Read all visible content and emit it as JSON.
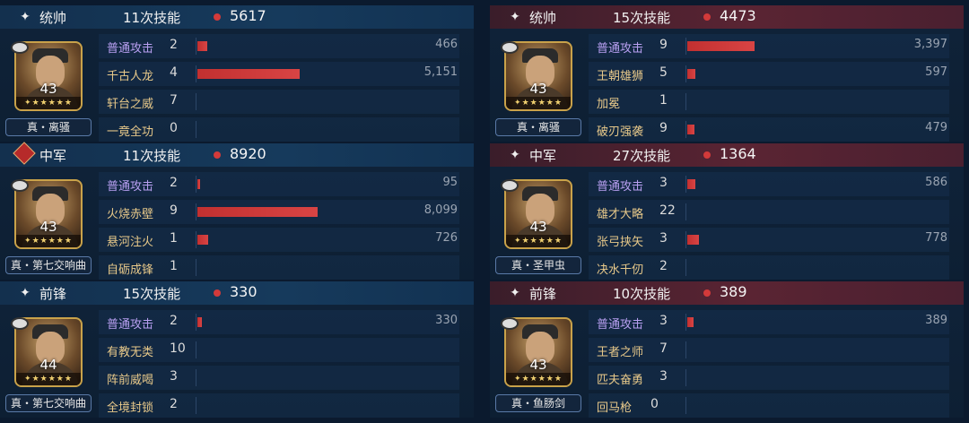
{
  "panels": [
    {
      "role": "统帅",
      "role_icon": "sparkle-icon",
      "skill_count": "11次技能",
      "damage_total": "5617",
      "level": "43",
      "stars": "✦★★★★★",
      "badge": "真・离骚",
      "skills": [
        {
          "name": "普通攻击",
          "count": "2",
          "damage": "466",
          "bar": 0.084,
          "type": "basic"
        },
        {
          "name": "千古人龙",
          "count": "4",
          "damage": "5,151",
          "bar": 0.85,
          "type": "skill"
        },
        {
          "name": "轩台之威",
          "count": "7",
          "damage": "",
          "bar": 0,
          "type": "skill"
        },
        {
          "name": "一竟全功",
          "count": "0",
          "damage": "",
          "bar": 0,
          "type": "skill"
        }
      ]
    },
    {
      "role": "中军",
      "role_icon": "diamond-icon",
      "skill_count": "11次技能",
      "damage_total": "8920",
      "level": "43",
      "stars": "✦★★★★★",
      "badge": "真・第七交响曲",
      "skills": [
        {
          "name": "普通攻击",
          "count": "2",
          "damage": "95",
          "bar": 0.012,
          "type": "basic"
        },
        {
          "name": "火烧赤壁",
          "count": "9",
          "damage": "8,099",
          "bar": 1.0,
          "type": "skill"
        },
        {
          "name": "悬河注火",
          "count": "1",
          "damage": "726",
          "bar": 0.09,
          "type": "skill"
        },
        {
          "name": "自砺成锋",
          "count": "1",
          "damage": "",
          "bar": 0,
          "type": "skill"
        }
      ]
    },
    {
      "role": "前锋",
      "role_icon": "sparkle-icon",
      "skill_count": "15次技能",
      "damage_total": "330",
      "level": "44",
      "stars": "✦★★★★★",
      "badge": "真・第七交响曲",
      "skills": [
        {
          "name": "普通攻击",
          "count": "2",
          "damage": "330",
          "bar": 0.04,
          "type": "basic"
        },
        {
          "name": "有教无类",
          "count": "10",
          "damage": "",
          "bar": 0,
          "type": "skill"
        },
        {
          "name": "阵前威喝",
          "count": "3",
          "damage": "",
          "bar": 0,
          "type": "skill"
        },
        {
          "name": "全境封锁",
          "count": "2",
          "damage": "",
          "bar": 0,
          "type": "skill"
        }
      ]
    },
    {
      "role": "统帅",
      "role_icon": "sparkle-icon",
      "skill_count": "15次技能",
      "damage_total": "4473",
      "level": "43",
      "stars": "✦★★★★★",
      "badge": "真・离骚",
      "skills": [
        {
          "name": "普通攻击",
          "count": "9",
          "damage": "3,397",
          "bar": 0.56,
          "type": "basic"
        },
        {
          "name": "王朝雄狮",
          "count": "5",
          "damage": "597",
          "bar": 0.07,
          "type": "skill"
        },
        {
          "name": "加冕",
          "count": "1",
          "damage": "",
          "bar": 0,
          "type": "skill"
        },
        {
          "name": "破刃强袭",
          "count": "9",
          "damage": "479",
          "bar": 0.06,
          "type": "skill"
        }
      ]
    },
    {
      "role": "中军",
      "role_icon": "sparkle-icon",
      "skill_count": "27次技能",
      "damage_total": "1364",
      "level": "43",
      "stars": "✦★★★★★",
      "badge": "真・圣甲虫",
      "skills": [
        {
          "name": "普通攻击",
          "count": "3",
          "damage": "586",
          "bar": 0.07,
          "type": "basic"
        },
        {
          "name": "雄才大略",
          "count": "22",
          "damage": "",
          "bar": 0,
          "type": "skill"
        },
        {
          "name": "张弓挟矢",
          "count": "3",
          "damage": "778",
          "bar": 0.1,
          "type": "skill"
        },
        {
          "name": "决水千仞",
          "count": "2",
          "damage": "",
          "bar": 0,
          "type": "skill"
        }
      ]
    },
    {
      "role": "前锋",
      "role_icon": "sparkle-icon",
      "skill_count": "10次技能",
      "damage_total": "389",
      "level": "43",
      "stars": "✦★★★★★",
      "badge": "真・鱼肠剑",
      "skills": [
        {
          "name": "普通攻击",
          "count": "3",
          "damage": "389",
          "bar": 0.05,
          "type": "basic"
        },
        {
          "name": "王者之师",
          "count": "7",
          "damage": "",
          "bar": 0,
          "type": "skill"
        },
        {
          "name": "匹夫奋勇",
          "count": "3",
          "damage": "",
          "bar": 0,
          "type": "skill"
        },
        {
          "name": "回马枪",
          "count": "0",
          "damage": "",
          "bar": 0,
          "type": "skill"
        }
      ]
    }
  ],
  "colors": {
    "left_header": "#163a5c",
    "right_header": "#5a2433",
    "bar": "#c23030",
    "basic_attack": "#b9a0f2",
    "skill": "#e8c98a"
  }
}
